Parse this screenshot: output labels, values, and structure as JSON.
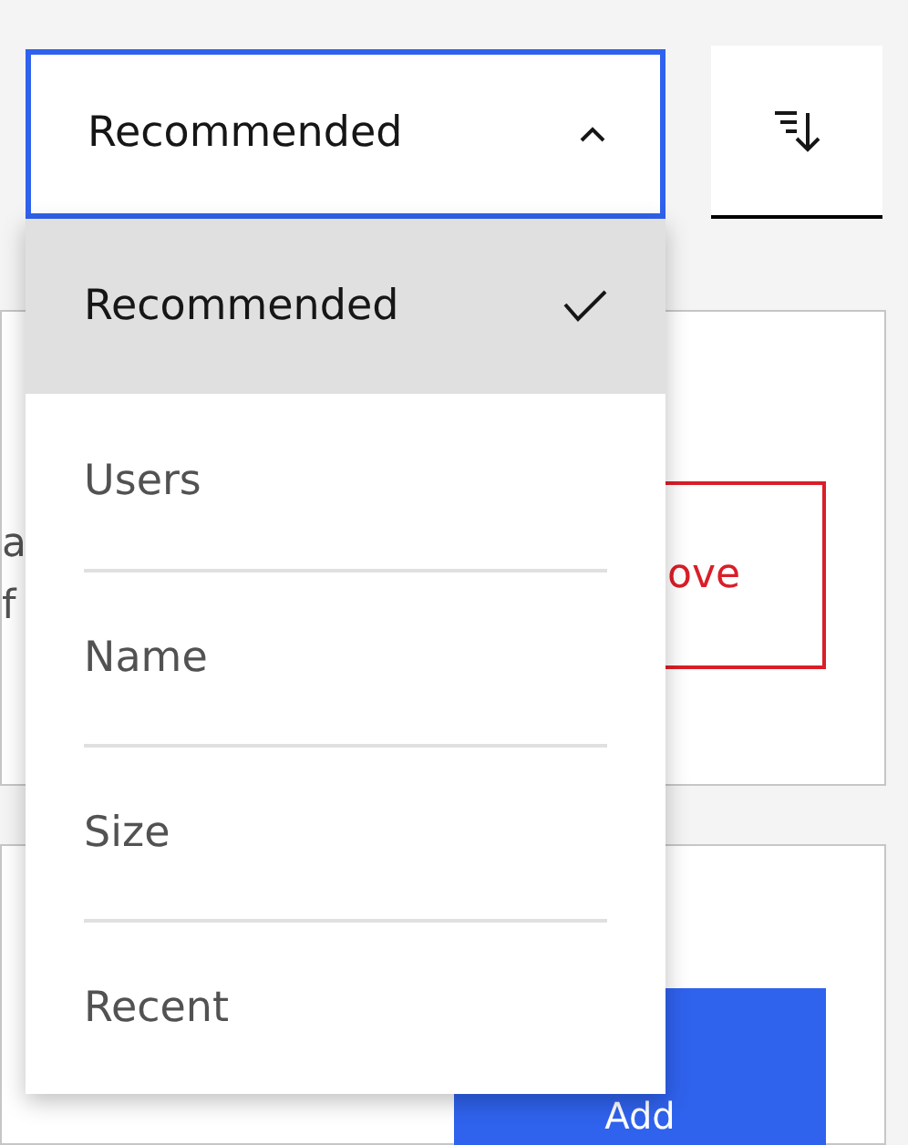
{
  "dropdown": {
    "value": "Recommended",
    "expanded": true
  },
  "menu": {
    "options": [
      {
        "label": "Recommended",
        "selected": true
      },
      {
        "label": "Users",
        "selected": false
      },
      {
        "label": "Name",
        "selected": false
      },
      {
        "label": "Size",
        "selected": false
      },
      {
        "label": "Recent",
        "selected": false
      }
    ]
  },
  "cards": [
    {
      "texts": [
        "a",
        "f"
      ],
      "button": {
        "kind": "danger",
        "label": "ove"
      }
    },
    {
      "button": {
        "kind": "primary",
        "label": "Add"
      }
    }
  ]
}
